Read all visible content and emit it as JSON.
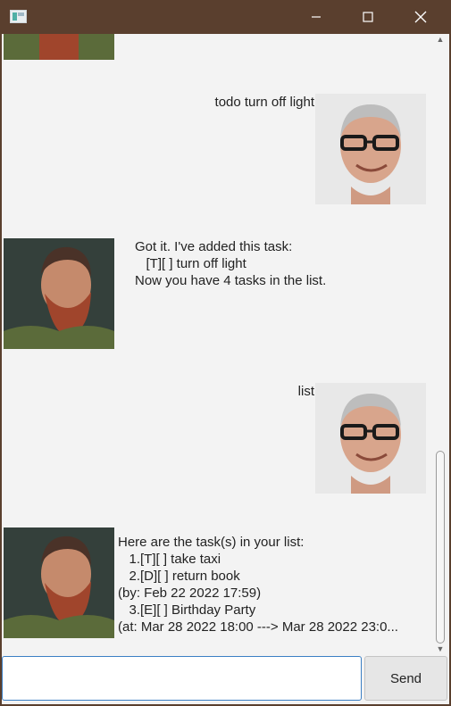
{
  "window": {
    "minimize_icon": "minimize-icon",
    "maximize_icon": "maximize-icon",
    "close_icon": "close-icon"
  },
  "chat": {
    "messages": [
      {
        "sender": "duke",
        "text": ""
      },
      {
        "sender": "user",
        "text": "todo turn off light"
      },
      {
        "sender": "duke",
        "text": "Got it. I've added this task:\n   [T][ ] turn off light\nNow you have 4 tasks in the list."
      },
      {
        "sender": "user",
        "text": "list"
      },
      {
        "sender": "duke",
        "text": "Here are the task(s) in your list:\n   1.[T][ ] take taxi\n   2.[D][ ] return book\n(by: Feb 22 2022 17:59)\n   3.[E][ ] Birthday Party\n(at: Mar 28 2022 18:00 ---> Mar 28 2022 23:0..."
      }
    ]
  },
  "input": {
    "value": "",
    "placeholder": ""
  },
  "send_button": {
    "label": "Send"
  },
  "colors": {
    "titlebar": "#5a3f2e",
    "background": "#f3f3f3",
    "input_border": "#3b7fc4"
  }
}
